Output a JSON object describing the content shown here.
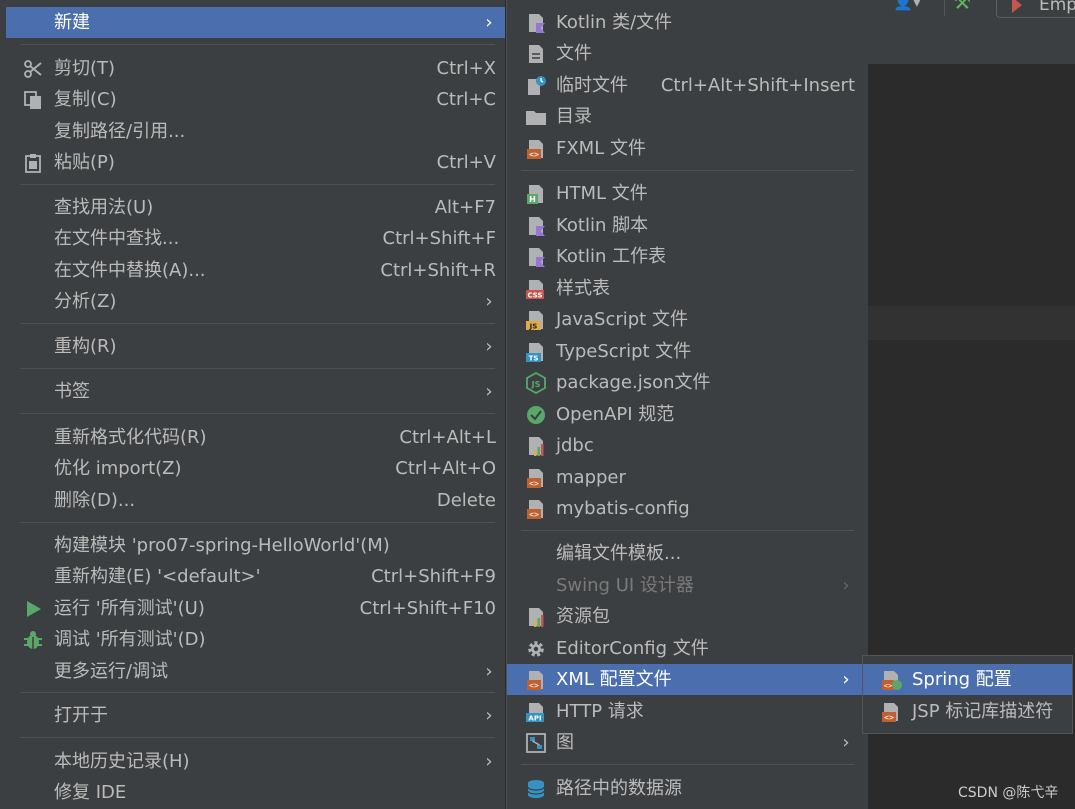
{
  "background": {
    "toolbar_text": "Emp"
  },
  "main_menu": {
    "items": [
      {
        "label": "新建",
        "shortcut": "",
        "arrow": "›"
      },
      {
        "label": "剪切(T)",
        "shortcut": "Ctrl+X"
      },
      {
        "label": "复制(C)",
        "shortcut": "Ctrl+C"
      },
      {
        "label": "复制路径/引用...",
        "shortcut": ""
      },
      {
        "label": "粘贴(P)",
        "shortcut": "Ctrl+V"
      },
      {
        "label": "查找用法(U)",
        "shortcut": "Alt+F7"
      },
      {
        "label": "在文件中查找...",
        "shortcut": "Ctrl+Shift+F"
      },
      {
        "label": "在文件中替换(A)...",
        "shortcut": "Ctrl+Shift+R"
      },
      {
        "label": "分析(Z)",
        "arrow": "›"
      },
      {
        "label": "重构(R)",
        "arrow": "›"
      },
      {
        "label": "书签",
        "arrow": "›"
      },
      {
        "label": "重新格式化代码(R)",
        "shortcut": "Ctrl+Alt+L"
      },
      {
        "label": "优化 import(Z)",
        "shortcut": "Ctrl+Alt+O"
      },
      {
        "label": "删除(D)...",
        "shortcut": "Delete"
      },
      {
        "label": "构建模块 'pro07-spring-HelloWorld'(M)",
        "shortcut": ""
      },
      {
        "label": "重新构建(E) '<default>'",
        "shortcut": "Ctrl+Shift+F9"
      },
      {
        "label": "运行 '所有测试'(U)",
        "shortcut": "Ctrl+Shift+F10"
      },
      {
        "label": "调试 '所有测试'(D)",
        "shortcut": ""
      },
      {
        "label": "更多运行/调试",
        "arrow": "›"
      },
      {
        "label": "打开于",
        "arrow": "›"
      },
      {
        "label": "本地历史记录(H)",
        "arrow": "›"
      },
      {
        "label": "修复 IDE",
        "shortcut": ""
      }
    ]
  },
  "new_menu": {
    "items": [
      {
        "label": "Kotlin 类/文件",
        "icon": "kotlin-file-icon"
      },
      {
        "label": "文件",
        "icon": "file-icon"
      },
      {
        "label": "临时文件",
        "shortcut": "Ctrl+Alt+Shift+Insert",
        "icon": "scratch-file-icon"
      },
      {
        "label": "目录",
        "icon": "folder-icon"
      },
      {
        "label": "FXML 文件",
        "icon": "xml-file-icon"
      },
      {
        "label": "HTML 文件",
        "icon": "html-file-icon"
      },
      {
        "label": "Kotlin 脚本",
        "icon": "kotlin-script-icon"
      },
      {
        "label": "Kotlin 工作表",
        "icon": "kotlin-worksheet-icon"
      },
      {
        "label": "样式表",
        "icon": "css-file-icon"
      },
      {
        "label": "JavaScript 文件",
        "icon": "js-file-icon"
      },
      {
        "label": "TypeScript 文件",
        "icon": "ts-file-icon"
      },
      {
        "label": "package.json文件",
        "icon": "nodejs-icon"
      },
      {
        "label": "OpenAPI 规范",
        "icon": "openapi-icon"
      },
      {
        "label": "jdbc",
        "icon": "properties-file-icon"
      },
      {
        "label": "mapper",
        "icon": "xml-file-icon"
      },
      {
        "label": "mybatis-config",
        "icon": "xml-file-icon"
      },
      {
        "label": "编辑文件模板...",
        "icon": ""
      },
      {
        "label": "Swing UI 设计器",
        "icon": "",
        "arrow": "›"
      },
      {
        "label": "资源包",
        "icon": "resource-bundle-icon"
      },
      {
        "label": "EditorConfig 文件",
        "icon": "gear-icon"
      },
      {
        "label": "XML 配置文件",
        "icon": "xml-file-icon",
        "arrow": "›"
      },
      {
        "label": "HTTP 请求",
        "icon": "api-file-icon"
      },
      {
        "label": "图",
        "icon": "diagram-icon",
        "arrow": "›"
      },
      {
        "label": "路径中的数据源",
        "icon": "database-icon"
      }
    ]
  },
  "xml_menu": {
    "items": [
      {
        "label": "Spring 配置",
        "icon": "spring-xml-icon"
      },
      {
        "label": "JSP 标记库描述符",
        "icon": "xml-file-icon"
      }
    ]
  },
  "watermark": "CSDN @陈弋辛"
}
